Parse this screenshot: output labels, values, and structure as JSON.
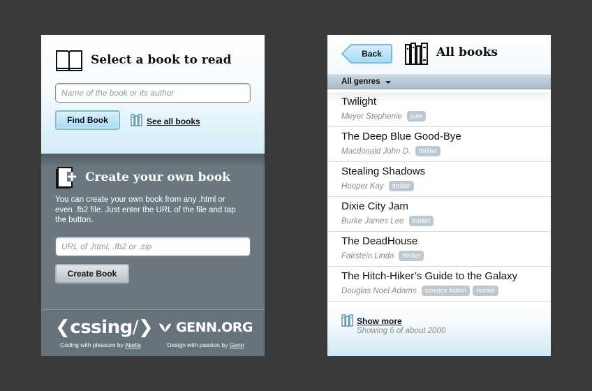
{
  "select": {
    "title": "Select a book to read",
    "search_placeholder": "Name of the book or its author",
    "find_button": "Find Book",
    "see_all": "See all books"
  },
  "create": {
    "title": "Create your own book",
    "description": "You can create your own book from any .html or even .fb2 file. Just enter the URL of the file and tap the button.",
    "url_placeholder": "URL of .html, .fb2 or .zip",
    "create_button": "Create Book"
  },
  "footer": {
    "left_logo": "cssing",
    "left_credit_prefix": "Coding with pleasure by",
    "left_credit_link": "Akella",
    "right_logo": "GENN.ORG",
    "right_credit_prefix": "Design with passion by",
    "right_credit_link": "Genn"
  },
  "list_view": {
    "back_button": "Back",
    "title": "All books",
    "genre_filter": "All genres",
    "books": [
      {
        "title": "Twilight",
        "author": "Meyer Stephenie",
        "tags": [
          "junk"
        ]
      },
      {
        "title": "The Deep Blue Good-Bye",
        "author": "Macdonald John D.",
        "tags": [
          "thriller"
        ]
      },
      {
        "title": "Stealing Shadows",
        "author": "Hooper Kay",
        "tags": [
          "thriller"
        ]
      },
      {
        "title": "Dixie City Jam",
        "author": "Burke James Lee",
        "tags": [
          "thriller"
        ]
      },
      {
        "title": "The DeadHouse",
        "author": "Fairstein Linda",
        "tags": [
          "thriller"
        ]
      },
      {
        "title": "The Hitch-Hiker’s Guide to the Galaxy",
        "author": "Douglas Noel Adams",
        "tags": [
          "science fiction",
          "humor"
        ]
      }
    ],
    "show_more": "Show more",
    "showing": "Showing 6 of about 2000"
  },
  "icons": [
    "open-book-icon",
    "library-icon",
    "new-book-icon",
    "back-arrow-icon",
    "books-shelf-icon",
    "dropdown-caret-icon"
  ],
  "colors": {
    "background": "#3a3a3a",
    "panel_gray": "#6b7880",
    "button_blue": "#a4dcf6",
    "tag": "#bcc9d2"
  }
}
